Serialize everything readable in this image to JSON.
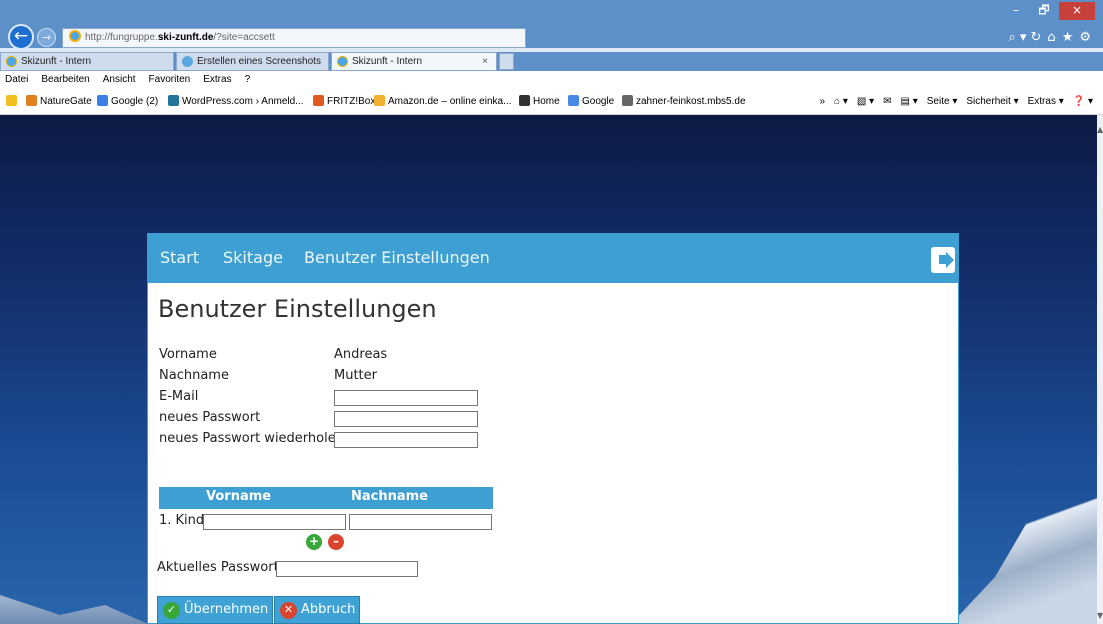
{
  "browser": {
    "url_prefix": "http://fungruppe.",
    "url_domain": "ski-zunft.de",
    "url_suffix": "/?site=accsett",
    "tabs": [
      {
        "label": "Skizunft - Intern"
      },
      {
        "label": "Erstellen eines Screenshots"
      },
      {
        "label": "Skizunft - Intern",
        "close": "×"
      }
    ],
    "menu": [
      "Datei",
      "Bearbeiten",
      "Ansicht",
      "Favoriten",
      "Extras",
      "?"
    ],
    "favorites": [
      "NatureGate",
      "Google (2)",
      "WordPress.com › Anmeld...",
      "FRITZ!Box",
      "Amazon.de – online einka...",
      "Home",
      "Google",
      "zahner-feinkost.mbs5.de"
    ],
    "command_bar": [
      "»",
      "Seite ▾",
      "Sicherheit ▾",
      "Extras ▾"
    ],
    "window_controls": {
      "minimize": "–",
      "restore": "🗗",
      "close": "×"
    },
    "right_icons": [
      "⌕ ▾ ↻",
      "⌂",
      "★",
      "⚙"
    ],
    "back": "←",
    "forward": "→"
  },
  "app": {
    "nav": [
      "Start",
      "Skitage",
      "Benutzer Einstellungen"
    ],
    "page_title": "Benutzer Einstellungen",
    "fields": {
      "vorname_label": "Vorname",
      "vorname_value": "Andreas",
      "nachname_label": "Nachname",
      "nachname_value": "Mutter",
      "email_label": "E-Mail",
      "email_value": "",
      "new_password_label": "neues Passwort",
      "repeat_password_label": "neues Passwort wiederholen"
    },
    "kids": {
      "headers": [
        "Vorname",
        "Nachname"
      ],
      "rows": [
        {
          "label": "1. Kind",
          "vorname": "",
          "nachname": ""
        }
      ],
      "add": "+",
      "remove": "–"
    },
    "current_password_label": "Aktuelles Passwort:",
    "buttons": {
      "apply": "Übernehmen",
      "cancel": "Abbruch"
    },
    "colors": {
      "accent": "#3d9fd2",
      "add": "#38a638",
      "remove": "#d9452f"
    }
  }
}
